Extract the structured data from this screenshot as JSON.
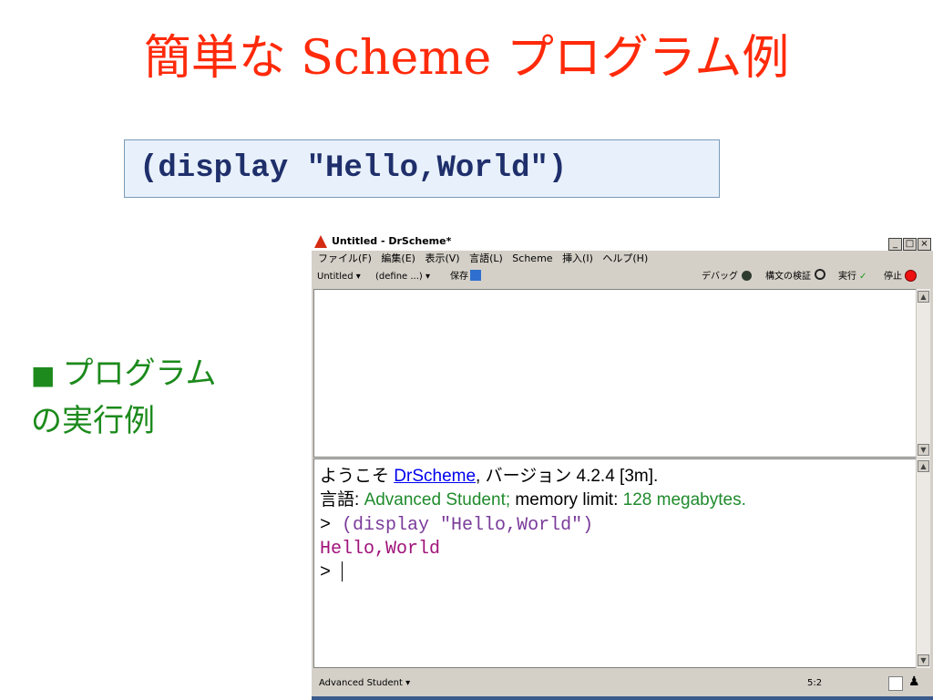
{
  "slide": {
    "title": "簡単な Scheme プログラム例",
    "code": "(display \"Hello,World\")",
    "bullet_line1": "プログラム",
    "bullet_line2": "の実行例"
  },
  "window": {
    "title": "Untitled - DrScheme*",
    "minimize": "_",
    "maximize": "□",
    "close": "×"
  },
  "menubar": [
    "ファイル(F)",
    "編集(E)",
    "表示(V)",
    "言語(L)",
    "Scheme",
    "挿入(I)",
    "ヘルプ(H)"
  ],
  "toolbar": {
    "file_menu": "Untitled ▾",
    "define_menu": "(define ...) ▾",
    "save": "保存",
    "debug": "デバッグ",
    "check_syntax": "構文の検証",
    "run": "実行",
    "stop": "停止"
  },
  "interactions": {
    "welcome_prefix": "ようこそ",
    "welcome_link": "DrScheme",
    "welcome_version_label": ", バージョン",
    "welcome_version": "4.2.4 [3m].",
    "lang_label": "言語:",
    "lang_name": "Advanced Student;",
    "mem_label": "memory limit:",
    "mem_value": "128 megabytes.",
    "prompt_symbol": ">",
    "repl_input": "(display \"Hello,World\")",
    "repl_output": "Hello,World",
    "prompt_symbol_2": ">"
  },
  "statusbar": {
    "language": "Advanced Student ▾",
    "position": "5:2"
  },
  "icons": {
    "app": "drscheme-lambda-icon",
    "save": "floppy-icon",
    "debug": "bug-icon",
    "check_syntax": "magnifier-icon",
    "run": "runner-icon",
    "stop": "stop-icon",
    "gc": "walker-icon"
  },
  "colors": {
    "slide_title": "#ff2a0a",
    "bullet": "#1c8a1c",
    "code_box_bg": "#e8f1fb",
    "repl_input": "#7a3b9a",
    "repl_output": "#a0127a",
    "link": "#0000ee",
    "lang_green": "#1f8b2c"
  }
}
